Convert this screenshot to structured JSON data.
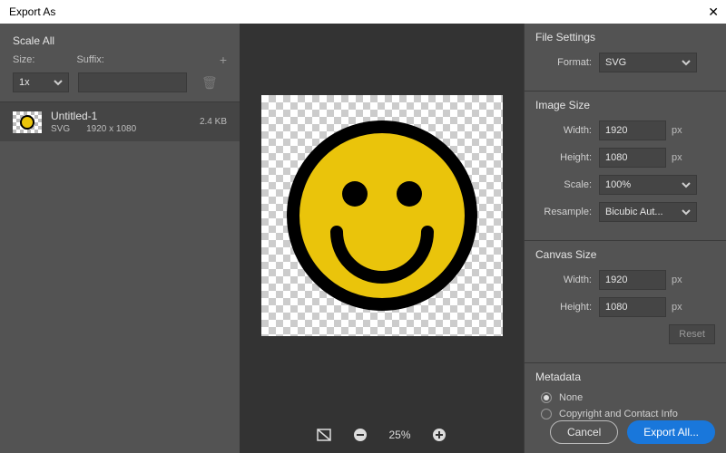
{
  "title": "Export As",
  "scale_all": {
    "title": "Scale All",
    "size_label": "Size:",
    "suffix_label": "Suffix:",
    "size_value": "1x",
    "suffix_value": ""
  },
  "asset": {
    "name": "Untitled-1",
    "format": "SVG",
    "dims": "1920 x 1080",
    "filesize": "2.4 KB"
  },
  "zoom": {
    "level": "25%"
  },
  "file_settings": {
    "title": "File Settings",
    "format_label": "Format:",
    "format_value": "SVG"
  },
  "image_size": {
    "title": "Image Size",
    "width_label": "Width:",
    "height_label": "Height:",
    "scale_label": "Scale:",
    "resample_label": "Resample:",
    "width": "1920",
    "height": "1080",
    "scale": "100%",
    "resample": "Bicubic Aut...",
    "unit": "px"
  },
  "canvas_size": {
    "title": "Canvas Size",
    "width_label": "Width:",
    "height_label": "Height:",
    "width": "1920",
    "height": "1080",
    "unit": "px",
    "reset": "Reset"
  },
  "metadata": {
    "title": "Metadata",
    "none": "None",
    "copyright": "Copyright and Contact Info"
  },
  "buttons": {
    "cancel": "Cancel",
    "export": "Export All..."
  }
}
